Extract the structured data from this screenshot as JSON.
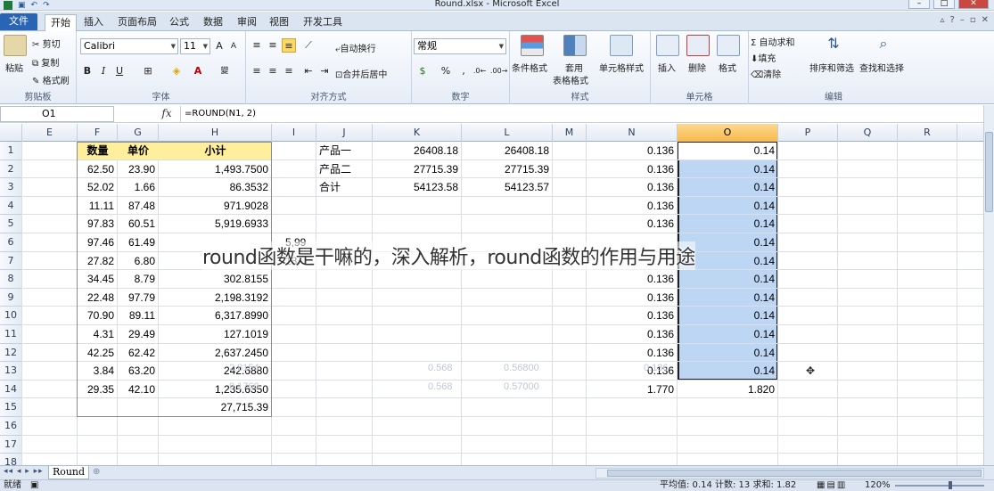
{
  "window": {
    "title": "Round.xlsx - Microsoft Excel",
    "quick_access": [
      "save",
      "undo",
      "redo"
    ]
  },
  "ribbon_tabs": [
    "文件",
    "开始",
    "插入",
    "页面布局",
    "公式",
    "数据",
    "审阅",
    "视图",
    "开发工具"
  ],
  "active_tab": "开始",
  "ribbon": {
    "clipboard": {
      "paste": "粘贴",
      "cut": "剪切",
      "copy": "复制",
      "format_painter": "格式刷",
      "label": "剪贴板"
    },
    "font": {
      "name": "Calibri",
      "size": "11",
      "bold": "B",
      "italic": "I",
      "underline": "U",
      "label": "字体"
    },
    "alignment": {
      "wrap": "自动换行",
      "merge": "合并后居中",
      "label": "对齐方式"
    },
    "number": {
      "format": "常规",
      "percent": "%",
      "comma": ",",
      "label": "数字"
    },
    "styles": {
      "conditional": "条件格式",
      "table": "套用",
      "table2": "表格格式",
      "cell_styles": "单元格样式",
      "label": "样式"
    },
    "cells": {
      "insert": "插入",
      "delete": "删除",
      "format": "格式",
      "label": "单元格"
    },
    "editing": {
      "autosum": "Σ 自动求和",
      "fill": "填充",
      "clear": "清除",
      "sort": "排序和筛选",
      "find": "查找和选择",
      "label": "编辑"
    }
  },
  "formula_bar": {
    "name_box": "O1",
    "fx": "fx",
    "formula": "=ROUND(N1, 2)"
  },
  "columns": [
    "E",
    "F",
    "G",
    "H",
    "I",
    "J",
    "K",
    "L",
    "M",
    "N",
    "O",
    "P",
    "Q",
    "R"
  ],
  "selected_column": "O",
  "rows": [
    "1",
    "2",
    "3",
    "4",
    "5",
    "6",
    "7",
    "8",
    "9",
    "10",
    "11",
    "12",
    "13",
    "14",
    "15",
    "16",
    "17",
    "18"
  ],
  "table_headers": {
    "qty": "数量",
    "price": "单价",
    "subtotal": "小计"
  },
  "table_rows": [
    {
      "f": "62.50",
      "g": "23.90",
      "h": "1,493.7500"
    },
    {
      "f": "52.02",
      "g": "1.66",
      "h": "86.3532"
    },
    {
      "f": "11.11",
      "g": "87.48",
      "h": "971.9028"
    },
    {
      "f": "97.83",
      "g": "60.51",
      "h": "5,919.6933"
    },
    {
      "f": "97.46",
      "g": "61.49",
      "h": "5,99"
    },
    {
      "f": "27.82",
      "g": "6.80",
      "h": "18"
    },
    {
      "f": "34.45",
      "g": "8.79",
      "h": "302.8155"
    },
    {
      "f": "22.48",
      "g": "97.79",
      "h": "2,198.3192"
    },
    {
      "f": "70.90",
      "g": "89.11",
      "h": "6,317.8990"
    },
    {
      "f": "4.31",
      "g": "29.49",
      "h": "127.1019"
    },
    {
      "f": "42.25",
      "g": "62.42",
      "h": "2,637.2450"
    },
    {
      "f": "3.84",
      "g": "63.20",
      "h": "242.6880"
    },
    {
      "f": "29.35",
      "g": "42.10",
      "h": "1,235.6350"
    }
  ],
  "total_h15": "27,715.39",
  "products": [
    {
      "name": "产品一",
      "k": "26408.18",
      "l": "26408.18"
    },
    {
      "name": "产品二",
      "k": "27715.39",
      "l": "27715.39"
    },
    {
      "name": "合计",
      "k": "54123.58",
      "l": "54123.57"
    }
  ],
  "n_values": [
    "0.136",
    "0.136",
    "0.136",
    "0.136",
    "0.136",
    "0.136",
    "0.136",
    "0.136",
    "0.136",
    "0.136",
    "0.136",
    "0.136",
    "0.136"
  ],
  "o_values": [
    "0.14",
    "0.14",
    "0.14",
    "0.14",
    "0.14",
    "0.14",
    "0.14",
    "0.14",
    "0.14",
    "0.14",
    "0.14",
    "0.14",
    "0.14"
  ],
  "n_total": "1.770",
  "o_total": "1.820",
  "ghost_text": {
    "h6": "2.8154",
    "h7": "9.1760",
    "k6": "0.568",
    "k7": "0.568",
    "l6": "0.56800",
    "l7": "0.57000",
    "n6": "0.136"
  },
  "caption": "round函数是干嘛的，深入解析，round函数的作用与用途",
  "sheet_tab": "Round",
  "status": {
    "ready": "就绪",
    "stats": "平均值: 0.14   计数: 13   求和: 1.82",
    "zoom": "120%"
  }
}
